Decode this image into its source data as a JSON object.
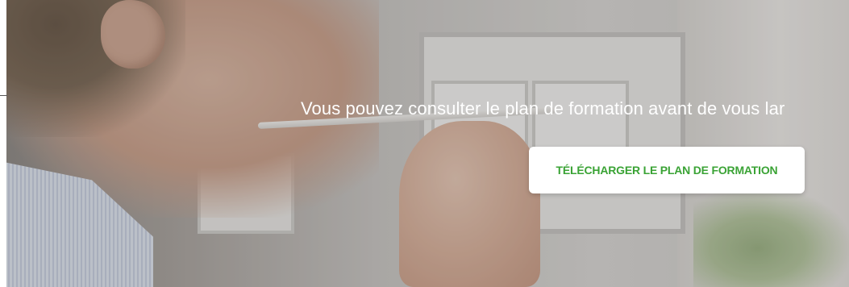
{
  "hero": {
    "tagline": "Vous pouvez consulter le plan de formation avant de vous lar",
    "cta_label": "TÉLÉCHARGER LE PLAN DE FORMATION"
  },
  "colors": {
    "accent_green": "#3aa335",
    "tagline_text": "#ffffff",
    "button_bg": "#ffffff"
  }
}
